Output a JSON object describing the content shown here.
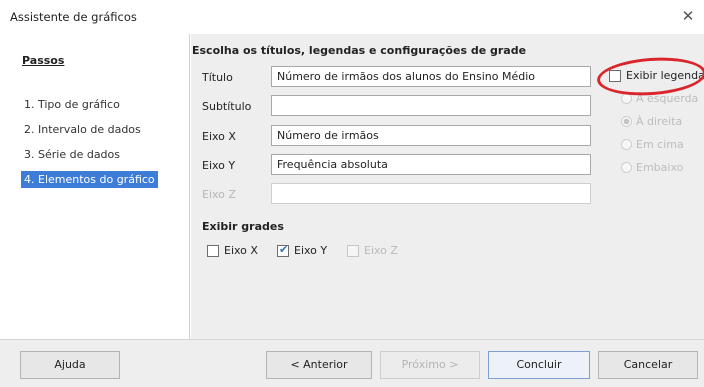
{
  "window": {
    "title": "Assistente de gráficos",
    "close_glyph": "✕"
  },
  "steps": {
    "header": "Passos",
    "items": [
      {
        "label": "1. Tipo de gráfico"
      },
      {
        "label": "2. Intervalo de dados"
      },
      {
        "label": "3. Série de dados"
      },
      {
        "label": "4. Elementos do gráfico"
      }
    ]
  },
  "main": {
    "section_title": "Escolha os títulos, legendas e configurações de grade",
    "fields": {
      "titulo": {
        "label": "Título",
        "value": "Número de irmãos dos alunos do Ensino Médio"
      },
      "subtitulo": {
        "label": "Subtítulo",
        "value": ""
      },
      "eixo_x": {
        "label": "Eixo X",
        "value": "Número de irmãos"
      },
      "eixo_y": {
        "label": "Eixo Y",
        "value": "Frequência absoluta"
      },
      "eixo_z": {
        "label": "Eixo Z",
        "value": ""
      }
    },
    "grids": {
      "title": "Exibir grades",
      "x": {
        "label": "Eixo X",
        "checked": false
      },
      "y": {
        "label": "Eixo Y",
        "checked": true
      },
      "z": {
        "label": "Eixo Z",
        "checked": false
      }
    },
    "legend": {
      "checkbox_label": "Exibir legenda",
      "checked": false,
      "options": [
        "À esquerda",
        "À direita",
        "Em cima",
        "Embaixo"
      ],
      "selected": "À direita"
    }
  },
  "buttons": {
    "help": "Ajuda",
    "previous": "< Anterior",
    "next": "Próximo >",
    "finish": "Concluir",
    "cancel": "Cancelar"
  },
  "colors": {
    "active_step": "#3d7dd8",
    "annotation_ring": "#d9262c"
  }
}
